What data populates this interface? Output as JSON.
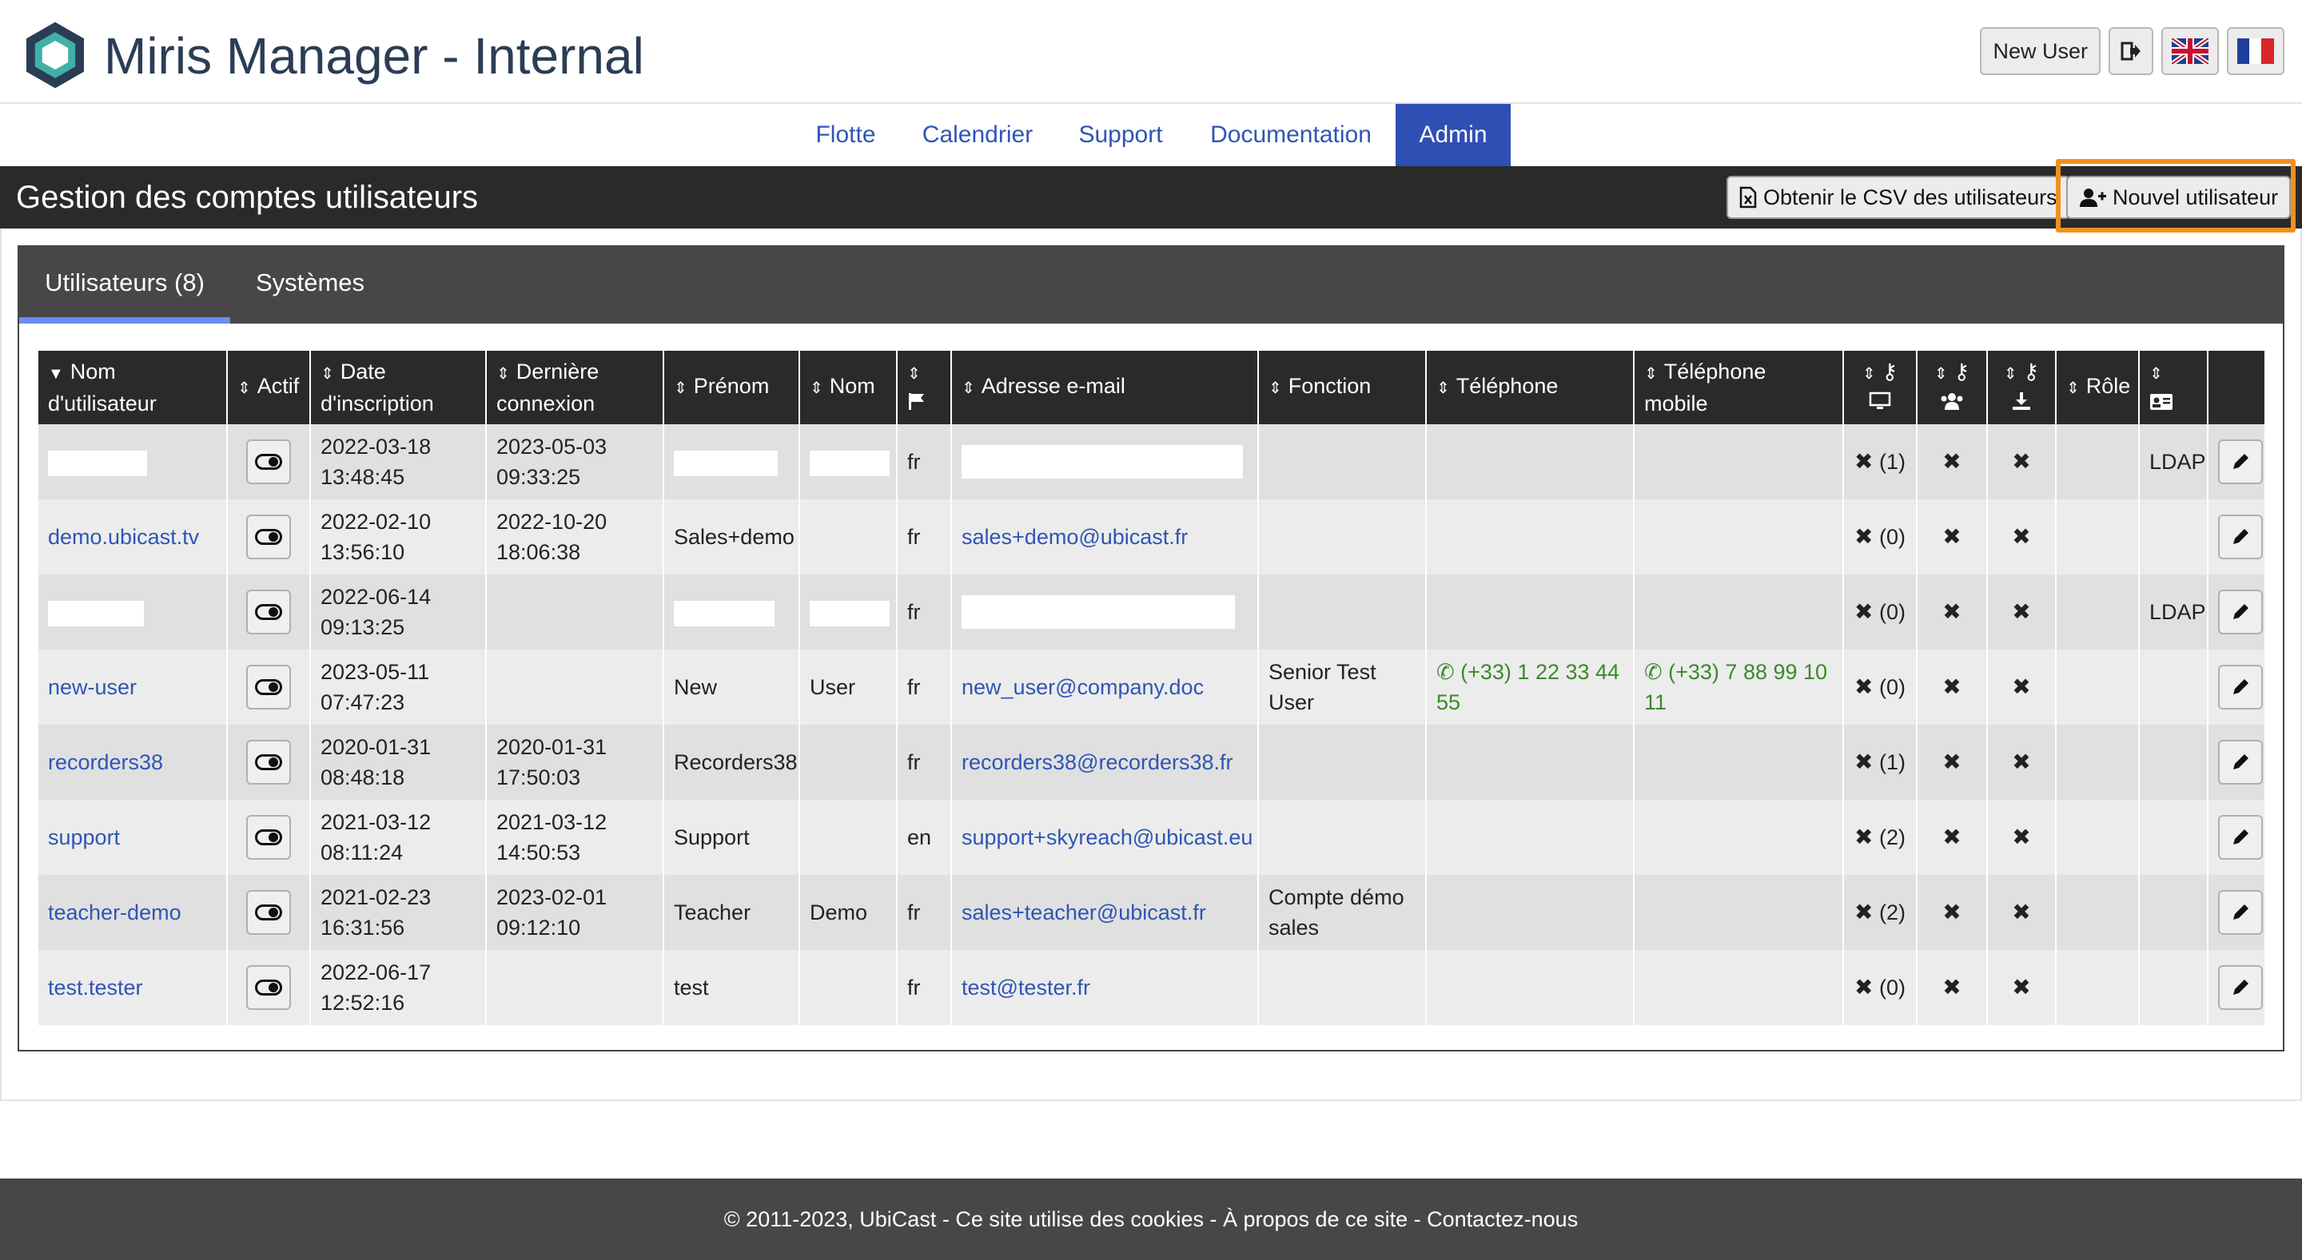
{
  "app": {
    "title": "Miris Manager - Internal"
  },
  "header": {
    "new_user_label": "New User"
  },
  "nav": {
    "tabs": [
      "Flotte",
      "Calendrier",
      "Support",
      "Documentation",
      "Admin"
    ],
    "active": "Admin"
  },
  "section": {
    "title": "Gestion des comptes utilisateurs",
    "csv_button": "Obtenir le CSV des utilisateurs",
    "new_user_button": "Nouvel utilisateur"
  },
  "panel_tabs": [
    "Utilisateurs (8)",
    "Systèmes"
  ],
  "table": {
    "headers": {
      "username": "Nom d'utilisateur",
      "active": "Actif",
      "signup": "Date d'inscription",
      "last_login": "Dernière connexion",
      "firstname": "Prénom",
      "lastname": "Nom",
      "email": "Adresse e-mail",
      "function": "Fonction",
      "phone": "Téléphone",
      "mobile": "Téléphone mobile",
      "role": "Rôle"
    },
    "rows": [
      {
        "username": "",
        "signup_date": "2022-03-18",
        "signup_time": "13:48:45",
        "login_date": "2023-05-03",
        "login_time": "09:33:25",
        "firstname": "",
        "lastname": "",
        "lang": "fr",
        "email": "",
        "function": "",
        "phone": "",
        "mobile": "",
        "systems": "(1)",
        "role": "LDAP",
        "redacted": true
      },
      {
        "username": "demo.ubicast.tv",
        "signup_date": "2022-02-10",
        "signup_time": "13:56:10",
        "login_date": "2022-10-20",
        "login_time": "18:06:38",
        "firstname": "Sales+demo",
        "lastname": "",
        "lang": "fr",
        "email": "sales+demo@ubicast.fr",
        "function": "",
        "phone": "",
        "mobile": "",
        "systems": "(0)",
        "role": ""
      },
      {
        "username": "",
        "signup_date": "2022-06-14",
        "signup_time": "09:13:25",
        "login_date": "",
        "login_time": "",
        "firstname": "",
        "lastname": "",
        "lang": "fr",
        "email": "",
        "function": "",
        "phone": "",
        "mobile": "",
        "systems": "(0)",
        "role": "LDAP",
        "redacted": true
      },
      {
        "username": "new-user",
        "signup_date": "2023-05-11",
        "signup_time": "07:47:23",
        "login_date": "",
        "login_time": "",
        "firstname": "New",
        "lastname": "User",
        "lang": "fr",
        "email": "new_user@company.doc",
        "function": "Senior Test User",
        "phone": "(+33) 1 22 33 44 55",
        "mobile": "(+33) 7 88 99 10 11",
        "systems": "(0)",
        "role": ""
      },
      {
        "username": "recorders38",
        "signup_date": "2020-01-31",
        "signup_time": "08:48:18",
        "login_date": "2020-01-31",
        "login_time": "17:50:03",
        "firstname": "Recorders38",
        "lastname": "",
        "lang": "fr",
        "email": "recorders38@recorders38.fr",
        "function": "",
        "phone": "",
        "mobile": "",
        "systems": "(1)",
        "role": ""
      },
      {
        "username": "support",
        "signup_date": "2021-03-12",
        "signup_time": "08:11:24",
        "login_date": "2021-03-12",
        "login_time": "14:50:53",
        "firstname": "Support",
        "lastname": "",
        "lang": "en",
        "email": "support+skyreach@ubicast.eu",
        "function": "",
        "phone": "",
        "mobile": "",
        "systems": "(2)",
        "role": ""
      },
      {
        "username": "teacher-demo",
        "signup_date": "2021-02-23",
        "signup_time": "16:31:56",
        "login_date": "2023-02-01",
        "login_time": "09:12:10",
        "firstname": "Teacher",
        "lastname": "Demo",
        "lang": "fr",
        "email": "sales+teacher@ubicast.fr",
        "function": "Compte démo sales",
        "phone": "",
        "mobile": "",
        "systems": "(2)",
        "role": ""
      },
      {
        "username": "test.tester",
        "signup_date": "2022-06-17",
        "signup_time": "12:52:16",
        "login_date": "",
        "login_time": "",
        "firstname": "test",
        "lastname": "",
        "lang": "fr",
        "email": "test@tester.fr",
        "function": "",
        "phone": "",
        "mobile": "",
        "systems": "(0)",
        "role": ""
      }
    ]
  },
  "footer": {
    "text": "© 2011-2023, UbiCast - Ce site utilise des cookies - À propos de ce site - Contactez-nous"
  },
  "icons": {
    "logout": "sign-out-icon",
    "flag_en": "uk-flag-icon",
    "flag_fr": "france-flag-icon",
    "toggle": "toggle-icon",
    "edit": "pencil-icon",
    "cross": "cross-icon"
  },
  "colors": {
    "accent": "#2f4fb5",
    "highlight": "#f0901e",
    "dark": "#2a2a2a",
    "phone": "#3a8a2a"
  }
}
